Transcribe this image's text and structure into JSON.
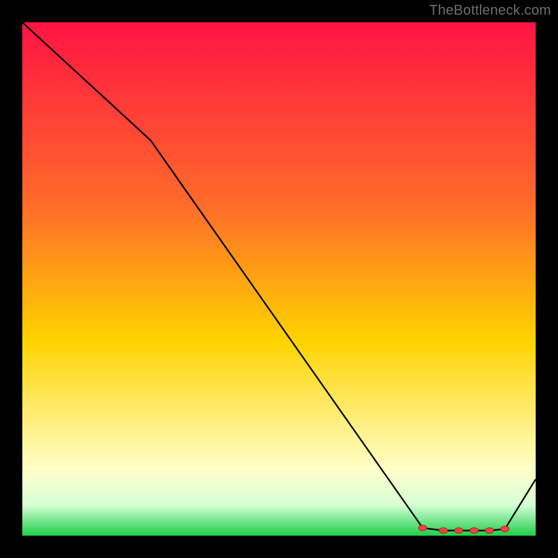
{
  "watermark": "TheBottleneck.com",
  "colors": {
    "black": "#000000",
    "line": "#000000",
    "marker_fill": "#ef4444",
    "marker_stroke": "#b91c1c",
    "gradient_top": "#ff1443",
    "gradient_mid_upper": "#ff6a2a",
    "gradient_mid": "#ffd300",
    "gradient_pale": "#ffffc8",
    "gradient_green_pale": "#d6ffd6",
    "gradient_green": "#1fce4a",
    "watermark_text": "#6e6e6e"
  },
  "chart_data": {
    "type": "line",
    "title": "",
    "xlabel": "",
    "ylabel": "",
    "xlim": [
      0,
      100
    ],
    "ylim": [
      0,
      100
    ],
    "categories": [
      0,
      25,
      78,
      82,
      85,
      88,
      91,
      94,
      100
    ],
    "values": [
      100,
      77,
      1.5,
      1.0,
      1.0,
      1.0,
      1.0,
      1.3,
      11
    ],
    "markers": {
      "x": [
        78,
        82,
        85,
        88,
        91,
        94
      ],
      "y": [
        1.5,
        1.0,
        1.0,
        1.0,
        1.0,
        1.3
      ]
    },
    "background_gradient_stops": [
      {
        "offset": 0.0,
        "color_key": "gradient_top"
      },
      {
        "offset": 0.35,
        "color_key": "gradient_mid_upper"
      },
      {
        "offset": 0.62,
        "color_key": "gradient_mid"
      },
      {
        "offset": 0.87,
        "color_key": "gradient_pale"
      },
      {
        "offset": 0.94,
        "color_key": "gradient_green_pale"
      },
      {
        "offset": 1.0,
        "color_key": "gradient_green"
      }
    ]
  }
}
